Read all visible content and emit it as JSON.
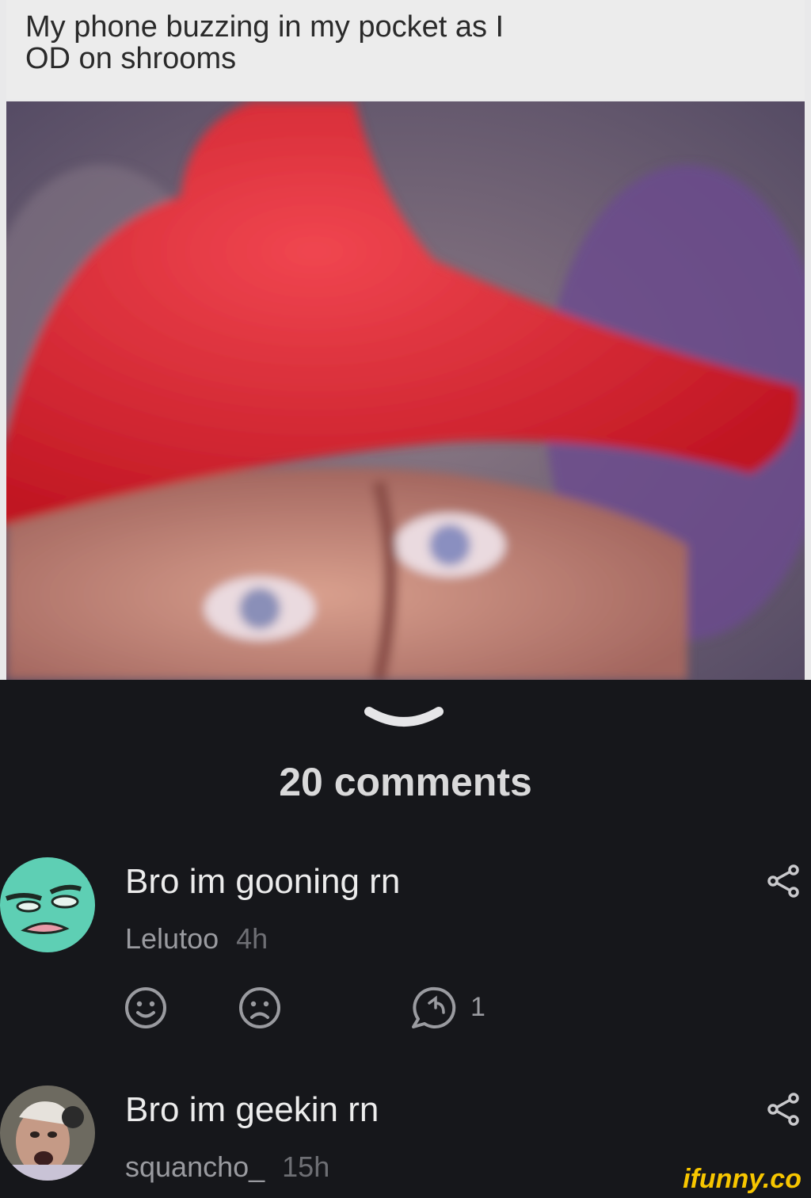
{
  "meme": {
    "caption_line1": "My phone buzzing in my pocket as I",
    "caption_line2": "OD on shrooms"
  },
  "comments_count": "20 comments",
  "comments": [
    {
      "text": "Bro im gooning rn",
      "user": "Lelutoo",
      "time": "4h",
      "reply_count": "1",
      "avatar_color": "#5ecfb4"
    },
    {
      "text": "Bro im geekin rn",
      "user": "squancho_",
      "time": "15h"
    }
  ],
  "icons": {
    "collapse": "chevron-down-icon",
    "smile": "smile-icon",
    "frown": "frown-icon",
    "reply": "reply-icon",
    "share": "share-icon"
  },
  "watermark": "ifunny.co",
  "colors": {
    "background": "#16171b",
    "watermark": "#f7c600",
    "hat": "#d81f2a"
  }
}
